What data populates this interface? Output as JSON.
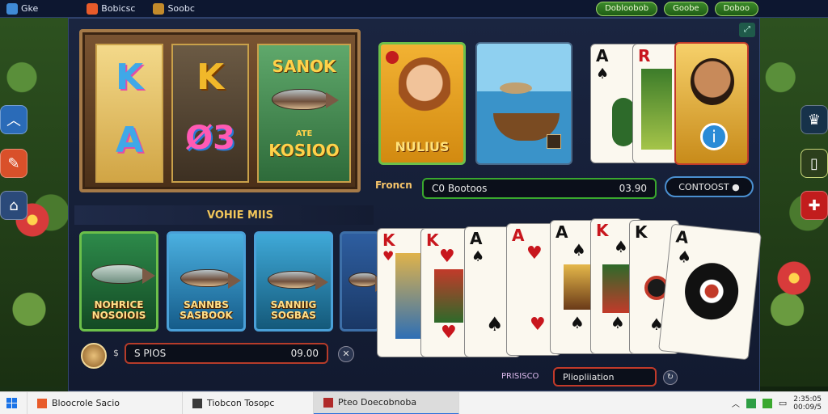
{
  "topbar": {
    "app_label": "Gke",
    "item1_label": "Bobicsc",
    "item2_label": "Soobc",
    "buttons": [
      "Dobloobob",
      "Goobe",
      "Doboo"
    ]
  },
  "slot": {
    "title_top": "SANOK",
    "title_bottom": "KOSIOO",
    "title_small": "ATE",
    "reel1": [
      "K",
      "A"
    ],
    "reel2": [
      "K",
      "Ø3"
    ]
  },
  "hero_card": {
    "label": "NULIUS"
  },
  "controls": {
    "bonus_label": "Froncn",
    "field_left": "C0 Bootoos",
    "field_value": "03.90",
    "contest_label": "CONTOOST ●",
    "section_title": "VOHIE MIIS"
  },
  "thumbs": [
    {
      "label": "NOHRICE NOSOIOIS",
      "bg": "#1f6a3a"
    },
    {
      "label": "SANNBS SASBOOK",
      "bg": "#1d5e86"
    },
    {
      "label": "SANNIIG SOGBAS",
      "bg": "#1a6f8a"
    }
  ],
  "bottom": {
    "field_left": "S PIOS",
    "field_value": "09.00",
    "bet_label": "PRISISCO",
    "play_label": "Pliopliiation"
  },
  "cards_fan": [
    "K",
    "K",
    "A",
    "A",
    "A",
    "K",
    "K",
    "A"
  ],
  "top_cards": [
    "A",
    "R"
  ],
  "taskbar": {
    "tasks": [
      "Bloocrole Sacio",
      "Tiobcon Tosopc",
      "Pteo Doecobnoba"
    ],
    "time": "2:35:05",
    "date": "00:09/5"
  },
  "colors": {
    "accent_green": "#3aa82e",
    "panel": "#121a30"
  }
}
